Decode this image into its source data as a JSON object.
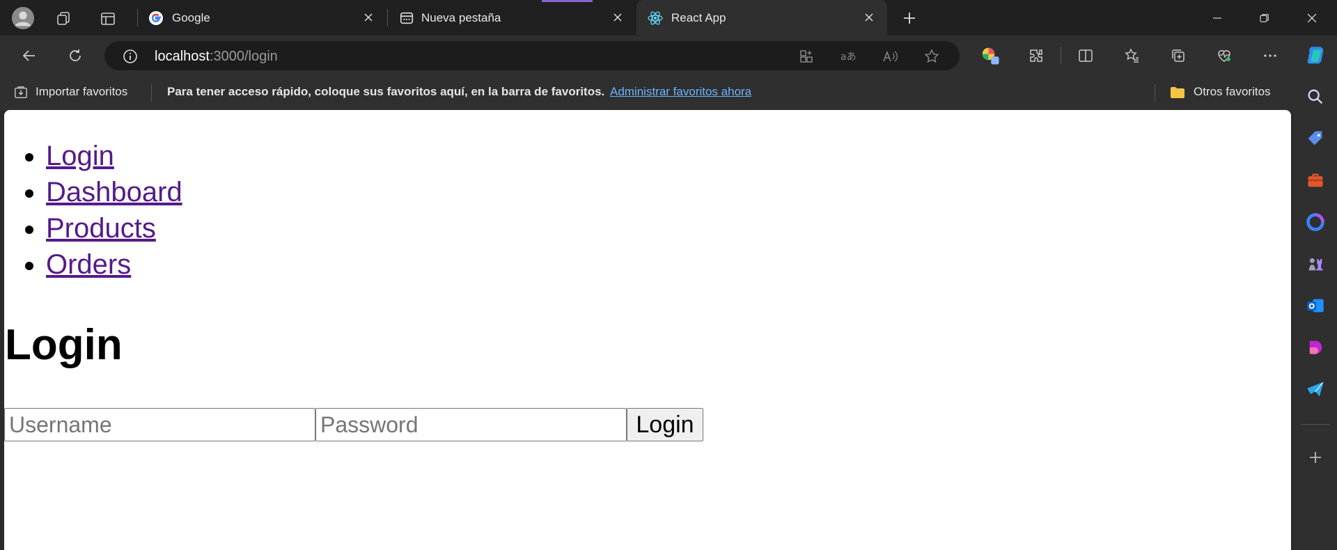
{
  "browser": {
    "tabs": [
      {
        "title": "Google",
        "icon": "google-icon"
      },
      {
        "title": "Nueva pestaña",
        "icon": "new-tab-icon"
      },
      {
        "title": "React App",
        "icon": "react-icon"
      }
    ],
    "address": {
      "host": "localhost",
      "path": ":3000/login"
    },
    "favorites_bar": {
      "import_label": "Importar favoritos",
      "message": "Para tener acceso rápido, coloque sus favoritos aquí, en la barra de favoritos.",
      "manage_link": "Administrar favoritos ahora",
      "other_favorites": "Otros favoritos"
    }
  },
  "page": {
    "nav": [
      "Login",
      "Dashboard",
      "Products",
      "Orders"
    ],
    "heading": "Login",
    "username_placeholder": "Username",
    "password_placeholder": "Password",
    "submit_label": "Login"
  },
  "colors": {
    "link_visited": "#551a8b",
    "favorites_link": "#6cb4ff",
    "tab_indicator": "#8a63d2"
  }
}
